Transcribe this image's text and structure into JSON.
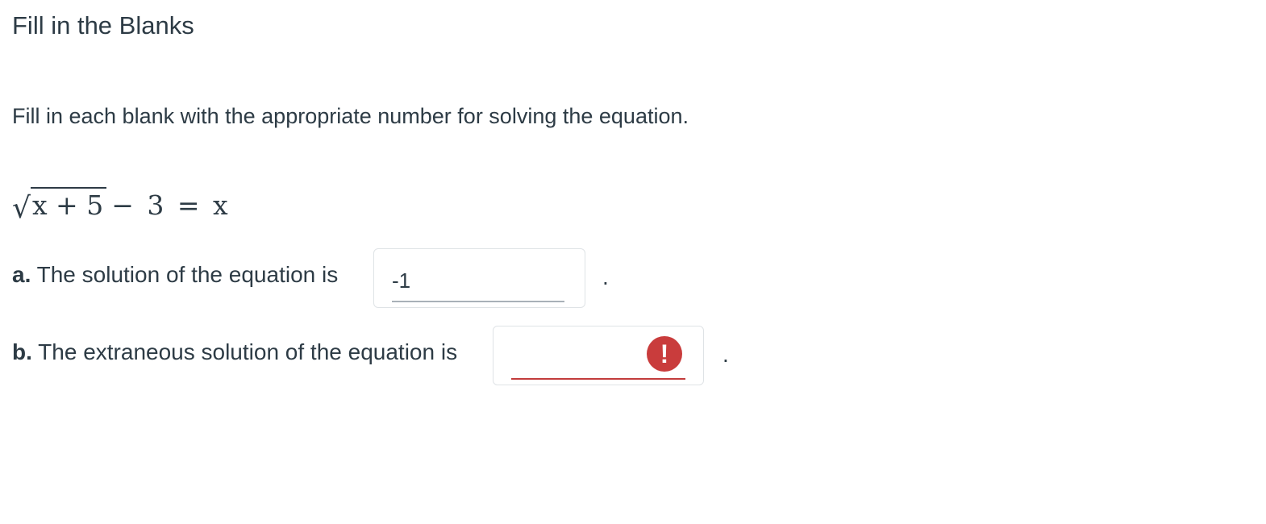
{
  "header": {
    "title": "Fill in the Blanks"
  },
  "problem": {
    "instructions": "Fill in each blank with the appropriate number for solving the equation.",
    "equation": {
      "radical_symbol": "√",
      "radicand": "x + 5",
      "rest": "− 3 = x"
    }
  },
  "questions": [
    {
      "letter": "a.",
      "text": " The solution of the equation is",
      "answer_value": "-1",
      "trailing": ".",
      "status": "normal"
    },
    {
      "letter": "b.",
      "text": " The extraneous solution of the equation is",
      "answer_value": "",
      "trailing": ".",
      "status": "error",
      "status_icon": "exclamation-error-icon",
      "status_glyph": "!"
    }
  ],
  "colors": {
    "text": "#2d3b45",
    "error": "#c93c3c",
    "input_border": "#dfe3e6"
  }
}
